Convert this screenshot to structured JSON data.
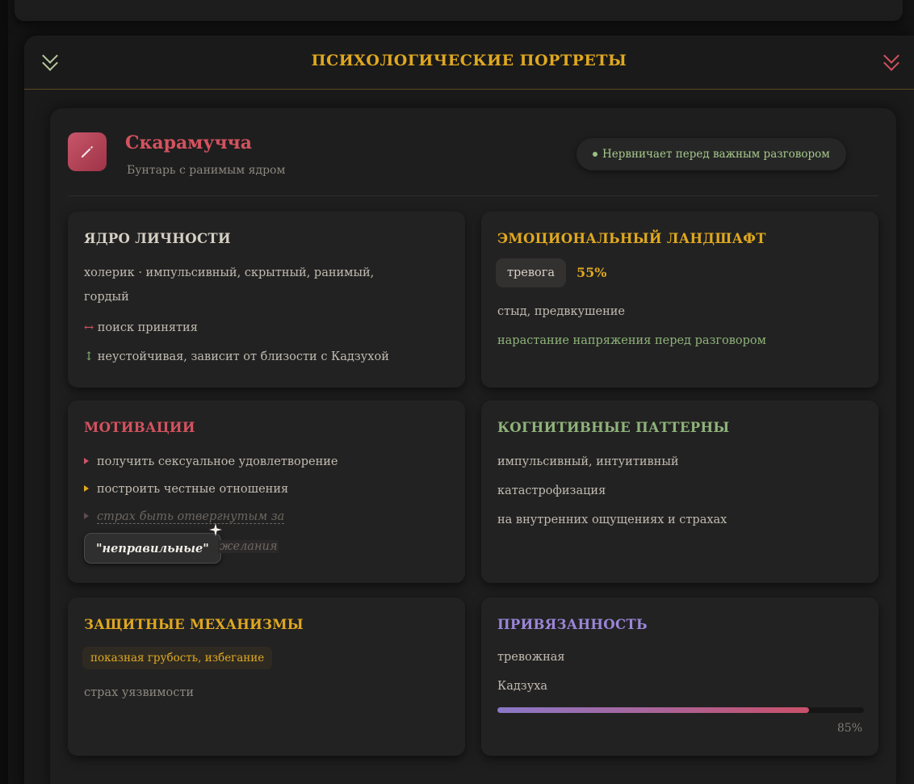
{
  "panel": {
    "title": "ПСИХОЛОГИЧЕСКИЕ ПОРТРЕТЫ"
  },
  "character": {
    "name": "Скарамучча",
    "subtitle": "Бунтарь с ранимым ядром",
    "status": "Нервничает перед важным разговором"
  },
  "core": {
    "title": "ЯДРО ЛИЧНОСТИ",
    "temperament_line1": "холерик · импульсивный, скрытный, ранимый,",
    "temperament_line2": "гордый",
    "conflict_arrow": "↔",
    "conflict": "поиск принятия",
    "stability_arrow": "↕",
    "stability": "неустойчивая, зависит от близости с Кадзухой"
  },
  "emotions": {
    "title": "ЭМОЦИОНАЛЬНЫЙ ЛАНДШАФТ",
    "primary": "тревога",
    "intensity": "55%",
    "secondary": "стыд, предвкушение",
    "trend": "нарастание напряжения перед разговором"
  },
  "motivations": {
    "title": "МОТИВАЦИИ",
    "items": [
      "получить сексуальное удовлетворение",
      "построить честные отношения"
    ],
    "fear_line": "страх быть отвергнутым за",
    "fear_highlight": "\"неправильные\"",
    "fear_tail": "желания"
  },
  "cognitive": {
    "title": "КОГНИТИВНЫЕ ПАТТЕРНЫ",
    "lines": [
      "импульсивный, интуитивный",
      "катастрофизация",
      "на внутренних ощущениях и страхах"
    ]
  },
  "defense": {
    "title": "ЗАЩИТНЫЕ МЕХАНИЗМЫ",
    "tag": "показная грубость, избегание",
    "note": "страх уязвимости"
  },
  "attachment": {
    "title": "ПРИВЯЗАННОСТЬ",
    "style": "тревожная",
    "target": "Кадзуха",
    "level": 0.85,
    "level_label": "85%"
  },
  "colors": {
    "accent_gold": "#e0a820",
    "accent_red": "#d4525f",
    "accent_green": "#8fb37a",
    "accent_purple": "#9b86d8"
  }
}
